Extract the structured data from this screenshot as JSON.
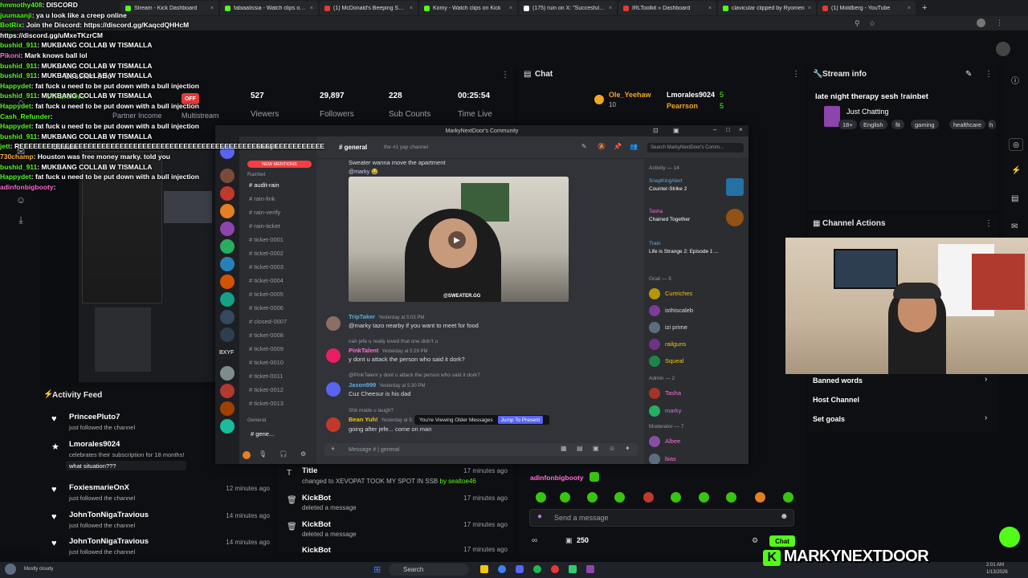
{
  "browser": {
    "tabs": [
      {
        "label": "Stream - Kick Dashboard",
        "color": "#53fc18"
      },
      {
        "label": "fabiaalissia - Watch clips on Kick",
        "color": "#53fc18"
      },
      {
        "label": "(1) McDonald's Beeping Sound Eff",
        "color": "#e53935"
      },
      {
        "label": "Komy - Watch clips on Kick",
        "color": "#53fc18"
      },
      {
        "label": "(175) ruin on X: \"Succesfully wat",
        "color": "#ffffff"
      },
      {
        "label": "IRLToolkit » Dashboard",
        "color": "#e53935"
      },
      {
        "label": "clavicular clipped by Ryomen",
        "color": "#53fc18"
      },
      {
        "label": "(1) Moldberg - YouTube",
        "color": "#e53935"
      }
    ],
    "new_tab": "+"
  },
  "overlay_chat": [
    {
      "user": "hmmothy408",
      "msg": "DISCORD",
      "color": "green"
    },
    {
      "user": "juumaanji",
      "msg": "ya u look like a creep online",
      "color": "green"
    },
    {
      "user": "BotRix",
      "msg": "Join the Discord: https://discord.gg/KaqcdQHHcM",
      "color": "green"
    },
    {
      "user": "",
      "msg": "https://discord.gg/uMxeTKzrCM",
      "color": "green"
    },
    {
      "user": "bushid_911",
      "msg": "MUKBANG COLLAB W TISMALLA",
      "color": "green"
    },
    {
      "user": "Pikoni",
      "msg": "Mark knows ball lol",
      "color": "pink"
    },
    {
      "user": "bushid_911",
      "msg": "MUKBANG COLLAB W TISMALLA",
      "color": "green"
    },
    {
      "user": "bushid_911",
      "msg": "MUKBANG COLLAB W TISMALLA",
      "color": "green"
    },
    {
      "user": "Happydet",
      "msg": "fat fuck u need to be put down with a bull injection",
      "color": "green"
    },
    {
      "user": "bushid_911",
      "msg": "MUKBANG COLLAB W TISMALLA",
      "color": "green"
    },
    {
      "user": "Happydet",
      "msg": "fat fuck u need to be put down with a bull injection",
      "color": "green"
    },
    {
      "user": "Cash_Refunder",
      "msg": "",
      "color": "green"
    },
    {
      "user": "Happydet",
      "msg": "fat fuck u need to be put down with a bull injection",
      "color": "green"
    },
    {
      "user": "bushid_911",
      "msg": "MUKBANG COLLAB W TISMALLA",
      "color": "green"
    },
    {
      "user": "jett",
      "msg": "REEEEEEEEEEEEEEEEEEEEEEEEEEEEEEEEEEEEEEEEEEEEEEEEEEEEEEEEEEEEEEEEEEE",
      "color": "green"
    },
    {
      "user": "730champ",
      "msg": "Houston was free money marky. told you",
      "color": "orange"
    },
    {
      "user": "bushid_911",
      "msg": "MUKBANG COLLAB W TISMALLA",
      "color": "green"
    },
    {
      "user": "Happydet",
      "msg": "fat fuck u need to be put down with a bull injection",
      "color": "green"
    },
    {
      "user": "adinfonbigbooty",
      "msg": "",
      "color": "pink"
    }
  ],
  "dashboard": {
    "stats": [
      {
        "value": "527",
        "label": "Viewers"
      },
      {
        "value": "29,897",
        "label": "Followers"
      },
      {
        "value": "228",
        "label": "Sub Counts"
      },
      {
        "value": "00:25:54",
        "label": "Time Live"
      }
    ],
    "status": "OFF",
    "streaming_label": "STREAMING",
    "partner_income": "Partner Income",
    "multistream": "Multistream",
    "session_info": "Session info",
    "stream_preview": "Stream Preview"
  },
  "activity_feed": {
    "title": "Activity Feed",
    "items": [
      {
        "name": "PrinceePluto7",
        "sub": "just followed the channel",
        "time": ""
      },
      {
        "name": "Lmorales9024",
        "sub": "celebrates their subscription for 18 months!",
        "extra": "what situation???",
        "time": ""
      },
      {
        "name": "FoxiesmarieOnX",
        "sub": "just followed the channel",
        "time": "12 minutes ago"
      },
      {
        "name": "JohnTonNigaTravious",
        "sub": "just followed the channel",
        "time": "14 minutes ago"
      },
      {
        "name": "JohnTonNigaTravious",
        "sub": "just followed the channel",
        "time": "14 minutes ago"
      }
    ]
  },
  "mid_list": [
    {
      "title": "Title",
      "sub": "changed to XEVOPAT TOOK MY SPOT IN SSB",
      "by": "by sealtoe46",
      "time": "17 minutes ago"
    },
    {
      "title": "KickBot",
      "sub": "deleted a message",
      "time": "17 minutes ago"
    },
    {
      "title": "KickBot",
      "sub": "deleted a message",
      "time": "17 minutes ago"
    },
    {
      "title": "KickBot",
      "sub": "",
      "time": "17 minutes ago"
    }
  ],
  "chat": {
    "title": "Chat",
    "pinned_users": [
      {
        "name": "Ole_Yeehaw",
        "count": "10"
      },
      {
        "name": "Lmorales9024",
        "count": "5"
      },
      {
        "name": "Pearrson",
        "count": "5"
      }
    ],
    "last_msg_user": "adinfonbigbooty",
    "input_placeholder": "Send a message",
    "viewer_count": "250",
    "send_label": "Chat"
  },
  "stream_info": {
    "title": "Stream info",
    "stream_title": "late night therapy sesh !rainbet",
    "category": "Just Chatting",
    "tags": [
      "18+",
      "English",
      "fit",
      "gaming",
      "healthcare",
      "h"
    ]
  },
  "channel_actions": {
    "title": "Channel Actions",
    "items": [
      "Banned words",
      "Host Channel",
      "Set goals"
    ]
  },
  "discord": {
    "window_title": "MarkyNextDoor's Community",
    "server_name": "MarkyN...",
    "channel_header": "general",
    "channel_topic": "the #1 yap channel",
    "search_placeholder": "Search MarkyNextDoor's Comm...",
    "new_mentions": "NEW MENTIONS",
    "channels": [
      "audit-rain",
      "rain-link",
      "rain-verify",
      "rain-ticket",
      "ticket-0001",
      "ticket-0002",
      "ticket-0003",
      "ticket-0004",
      "ticket-0005",
      "ticket-0006",
      "closed-0007",
      "ticket-0008",
      "ticket-0009",
      "ticket-0010",
      "ticket-0011",
      "ticket-0012",
      "ticket-0013"
    ],
    "category_rainbet": "Rainbet",
    "category_general": "General",
    "current_channel_short": "gene...",
    "bxyf": "BXYF",
    "messages": [
      {
        "reply": "",
        "user": "",
        "time": "",
        "text": "Sweater wanna move the apartment"
      },
      {
        "reply": "",
        "user": "TripTaker",
        "time": "Yesterday at 5:03 PM",
        "text": "@marky tazo nearby if you want to meet for food"
      },
      {
        "reply": "nah jefe u really loved that one didn't u",
        "user": "PinkTalent",
        "time": "Yesterday at 5:29 PM",
        "text": "y dont u attack the person who said it dork?"
      },
      {
        "reply": "@PinkTalent y dont u attack the person who said it dork?",
        "user": "Jason999",
        "time": "Yesterday at 5:30 PM",
        "text": "Cuz Cheesur is his dad"
      },
      {
        "reply": "Shit made u laugh?",
        "user": "Bean Yuh!",
        "time": "Yesterday at 5:",
        "text": "going after jefe... come on man"
      }
    ],
    "video_caption": "@SWEATER.GG",
    "older_banner": "You're Viewing Older Messages",
    "jump_label": "Jump To Present",
    "input_placeholder": "Message # | general",
    "members": {
      "activity_header": "Activity — 14",
      "activity": [
        {
          "name": "SnapKingAlert",
          "sub": "Counter-Strike 2"
        },
        {
          "name": "Tasha",
          "sub": "Chained Together"
        },
        {
          "name": "Train",
          "sub": "Life is Strange 2: Episode 1 ..."
        }
      ],
      "goat_header": "Goat — 5",
      "goat": [
        "Curtriches",
        "isthiscaleb",
        "izi prime",
        "railguns",
        "Squeal"
      ],
      "admin_header": "Admin — 2",
      "admin": [
        "Tasha",
        "marky"
      ],
      "mod_header": "Moderator — 7",
      "mods": [
        "Albee",
        "bias"
      ]
    }
  },
  "watermark": "MARKYNEXTDOOR",
  "taskbar": {
    "search": "Search",
    "weather": "Mostly cloudy",
    "time": "2:01 AM",
    "date": "1/13/2026"
  },
  "colors": {
    "kick_green": "#53fc18",
    "discord_blurple": "#5865f2",
    "live_red": "#e53935"
  }
}
